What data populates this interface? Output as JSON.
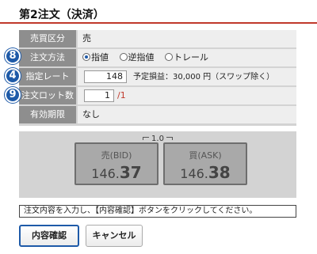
{
  "header": {
    "title": "第2注文（決済）"
  },
  "form": {
    "side": {
      "label": "売買区分",
      "value": "売"
    },
    "order_method": {
      "label": "注文方法",
      "options": [
        {
          "label": "指値",
          "selected": true
        },
        {
          "label": "逆指値",
          "selected": false
        },
        {
          "label": "トレール",
          "selected": false
        }
      ]
    },
    "price": {
      "label": "指定レート",
      "value": "148",
      "hint": "予定損益：30,000 円（スワップ除く）"
    },
    "quantity": {
      "label": "注文ロット数",
      "value": "1",
      "limit": "/1"
    },
    "expiry": {
      "label": "有効期限",
      "value": "なし"
    }
  },
  "badges": [
    "8",
    "4",
    "9"
  ],
  "quote": {
    "spread": "1.0",
    "bid": {
      "label": "売(BID)",
      "price_major": "146.",
      "price_minor": "37"
    },
    "ask": {
      "label": "買(ASK)",
      "price_major": "146.",
      "price_minor": "38"
    }
  },
  "message": "注文内容を入力し、【内容確認】ボタンをクリックしてください。",
  "buttons": {
    "confirm": "内容確認",
    "cancel": "キャンセル"
  },
  "colors": {
    "accent": "#1e5aa8",
    "title_underline": "#c0392b",
    "label_bg": "#8e8e8e",
    "panel_bg": "#d3d3d3"
  }
}
